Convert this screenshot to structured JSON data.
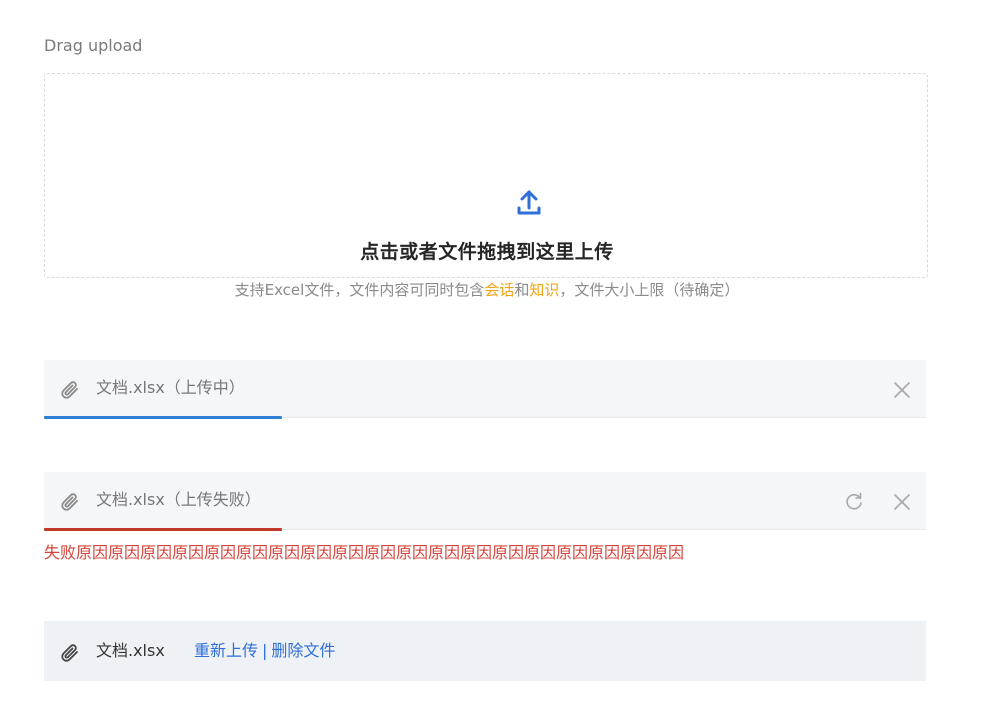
{
  "label": "Drag upload",
  "dropzone": {
    "title": "点击或者文件拖拽到这里上传",
    "hint_before": "支持Excel文件，文件内容可同时包含",
    "hint_hl1": "会话",
    "hint_mid": "和",
    "hint_hl2": "知识",
    "hint_after": "，文件大小上限（待确定）",
    "icon": "upload-icon"
  },
  "files": {
    "uploading": {
      "name": "文档.xlsx（上传中）",
      "progress": 0.27,
      "progress_color": "#2f7fd6"
    },
    "failed": {
      "name": "文档.xlsx（上传失败）",
      "progress": 0.27,
      "progress_color": "#c0392b",
      "reason": "失败原因原因原因原因原因原因原因原因原因原因原因原因原因原因原因原因原因原因原因"
    },
    "done": {
      "name": "文档.xlsx",
      "reupload": "重新上传",
      "separator": "|",
      "delete": "删除文件"
    }
  },
  "colors": {
    "accent": "#2f6fd6",
    "highlight": "#f2a313",
    "error": "#d4443a"
  }
}
